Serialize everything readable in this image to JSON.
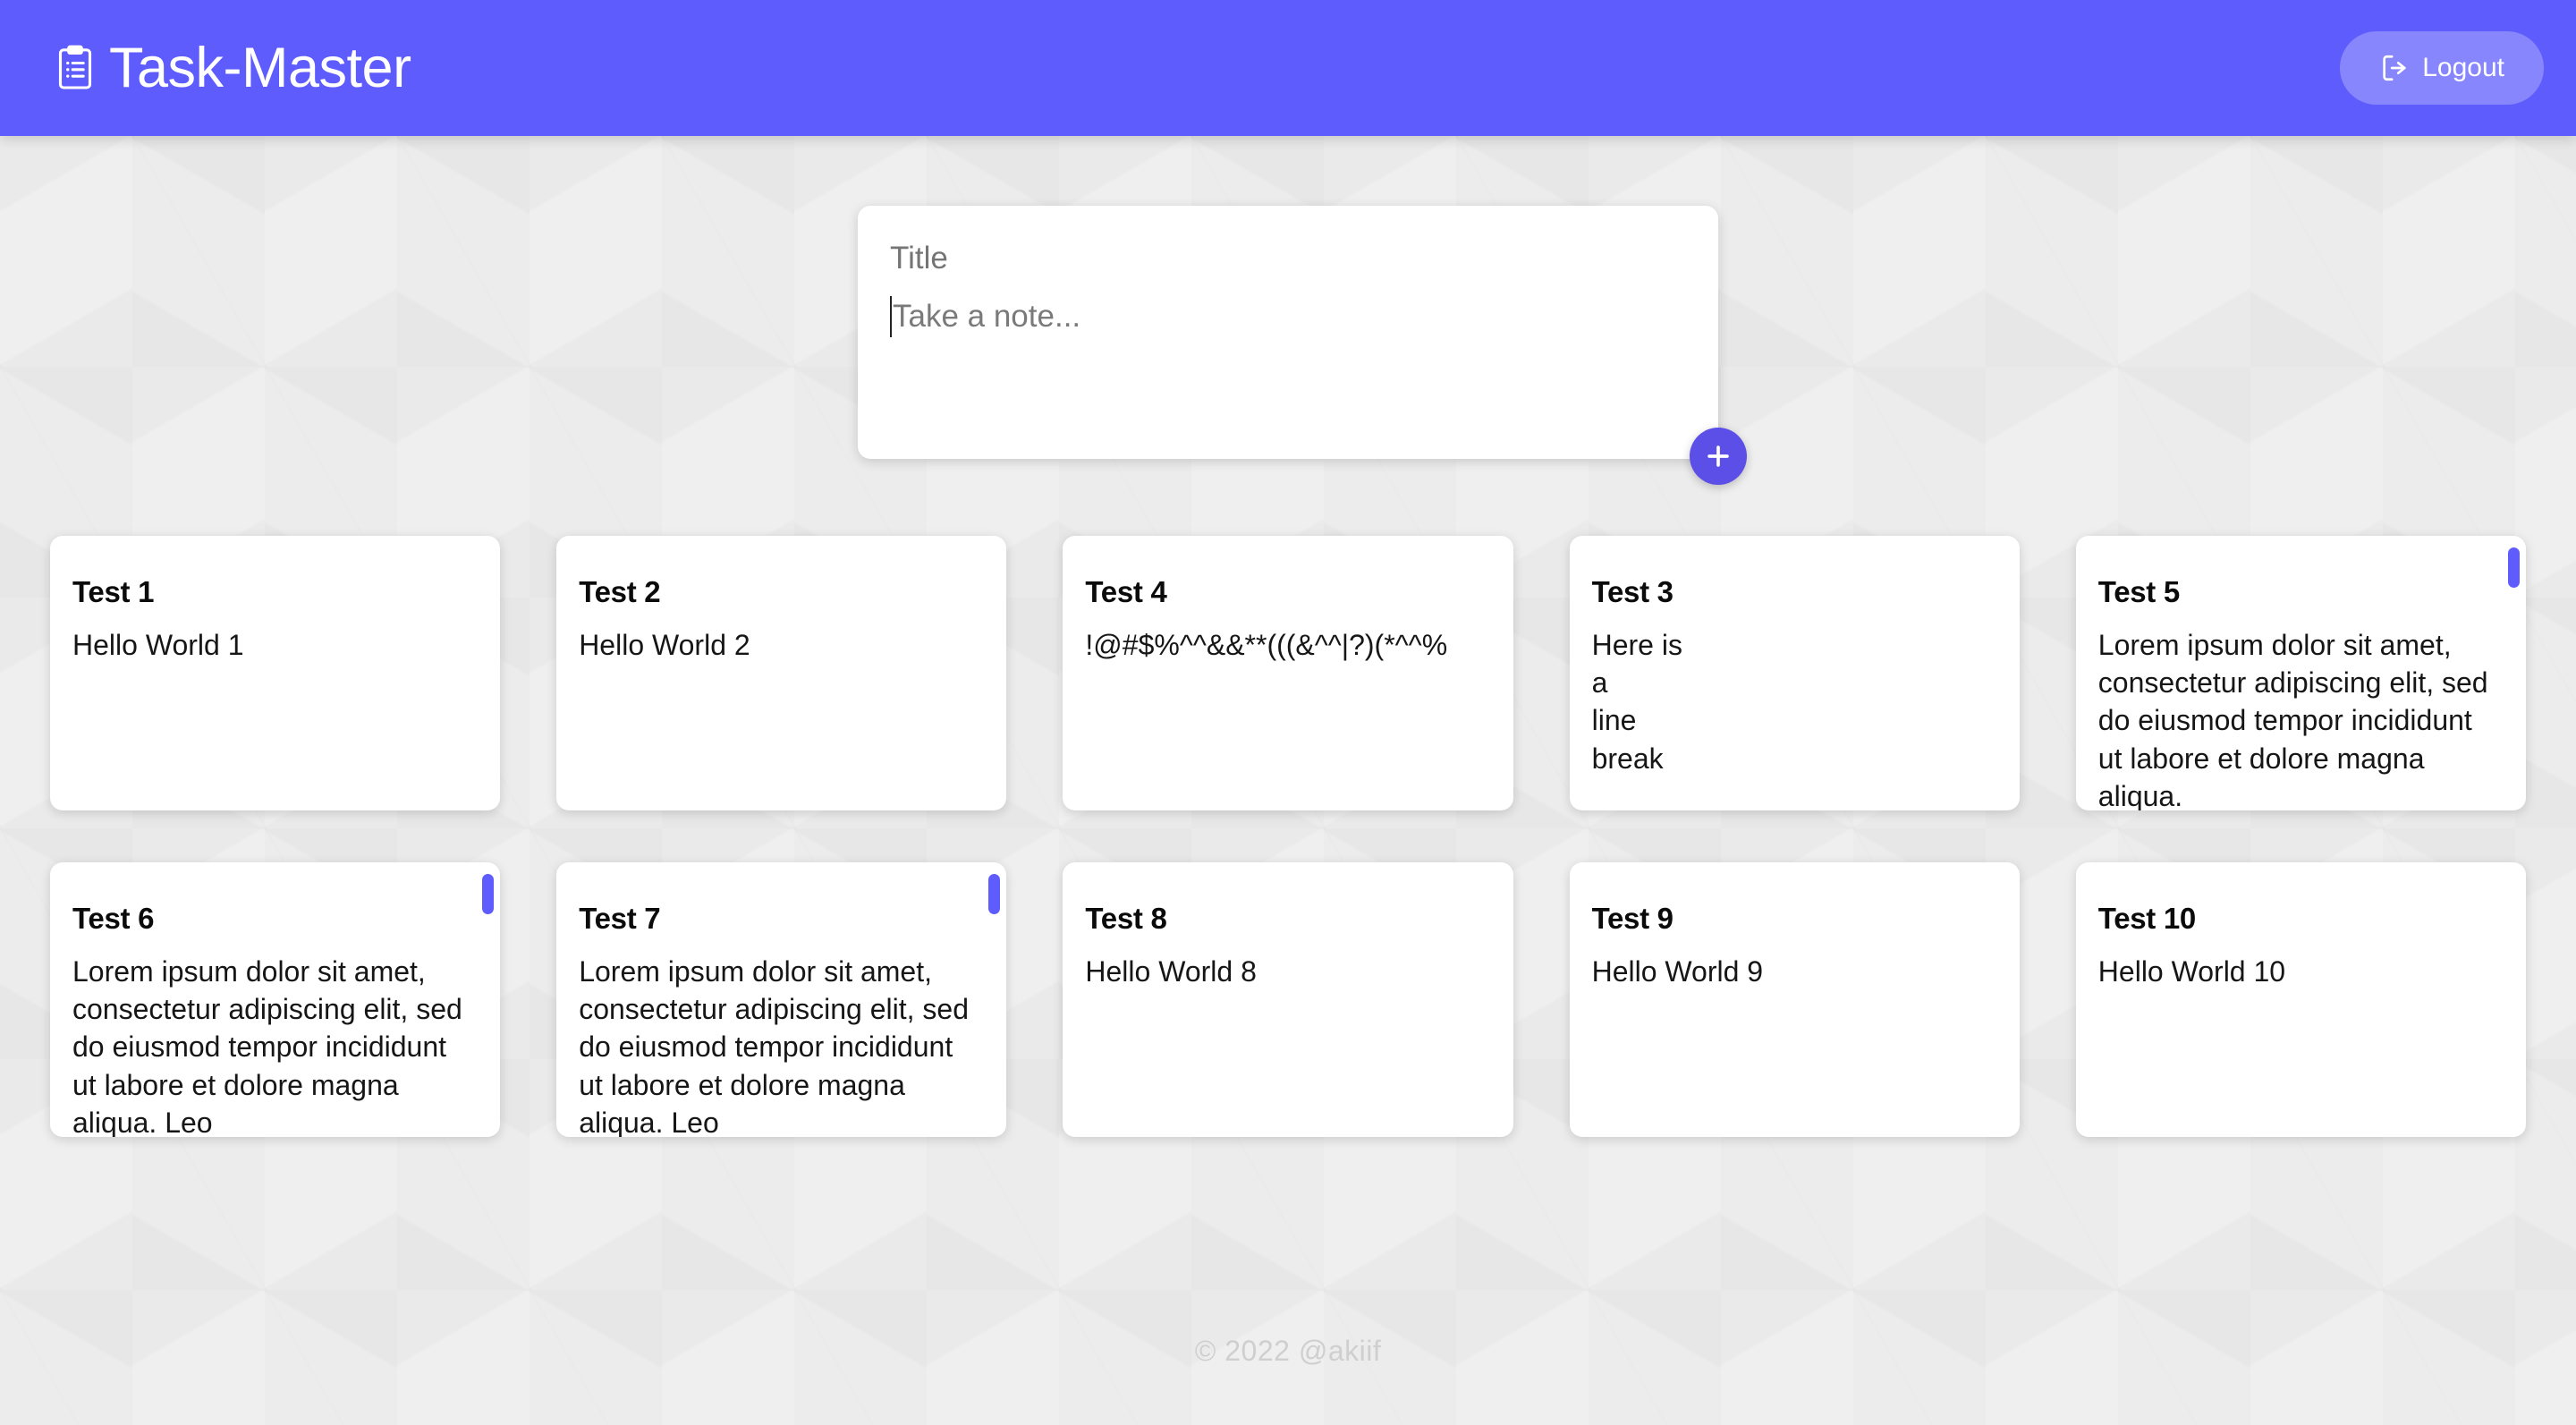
{
  "header": {
    "brand_title": "Task-Master",
    "brand_icon": "clipboard-icon",
    "logout_label": "Logout",
    "logout_icon": "logout-icon",
    "background_color": "#5f5cfd"
  },
  "composer": {
    "title_placeholder": "Title",
    "title_value": "",
    "note_placeholder": "Take a note...",
    "note_value": "",
    "add_icon": "plus-icon",
    "add_button_color": "#5b4fe8"
  },
  "notes": [
    {
      "title": "Test 1",
      "body": "Hello World 1",
      "scrollable": false
    },
    {
      "title": "Test 2",
      "body": "Hello World 2",
      "scrollable": false
    },
    {
      "title": "Test 4",
      "body": "!@#$%^^&&**(((&^^|?)(*^^%",
      "scrollable": false
    },
    {
      "title": "Test 3",
      "body": "Here is\na\nline\nbreak",
      "scrollable": false
    },
    {
      "title": "Test 5",
      "body": "Lorem ipsum dolor sit amet, consectetur adipiscing elit, sed do eiusmod tempor incididunt ut labore et dolore magna aliqua.",
      "scrollable": true
    },
    {
      "title": "Test 6",
      "body": "Lorem ipsum dolor sit amet, consectetur adipiscing elit, sed do eiusmod tempor incididunt ut labore et dolore magna aliqua. Leo",
      "scrollable": true
    },
    {
      "title": "Test 7",
      "body": "Lorem ipsum dolor sit amet, consectetur adipiscing elit, sed do eiusmod tempor incididunt ut labore et dolore magna aliqua. Leo",
      "scrollable": true
    },
    {
      "title": "Test 8",
      "body": "Hello World 8",
      "scrollable": false
    },
    {
      "title": "Test 9",
      "body": "Hello World 9",
      "scrollable": false
    },
    {
      "title": "Test 10",
      "body": "Hello World 10",
      "scrollable": false
    }
  ],
  "footer": {
    "text": "© 2022  @akiif"
  },
  "theme": {
    "accent": "#5f5cfd",
    "fab": "#5b4fe8",
    "page_background": "#efefef",
    "card_background": "#ffffff",
    "footer_text": "#cfcfcf"
  }
}
